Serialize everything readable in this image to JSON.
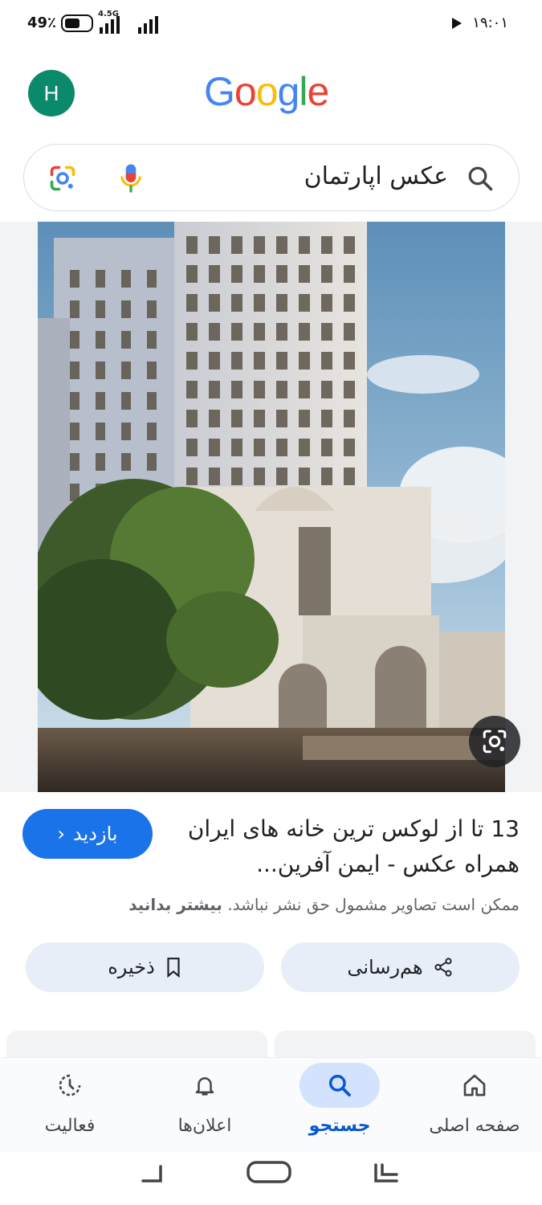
{
  "status_bar": {
    "battery": "49٪",
    "network": "4.5G",
    "time": "۱۹:۰۱"
  },
  "header": {
    "avatar_letter": "H",
    "logo_letters": [
      "G",
      "o",
      "o",
      "g",
      "l",
      "e"
    ],
    "logo_colors": [
      "#4285F4",
      "#EA4335",
      "#FBBC05",
      "#4285F4",
      "#34A853",
      "#EA4335"
    ]
  },
  "search": {
    "query": "عکس اپارتمان"
  },
  "result": {
    "title": "13 تا از لوکس ترین خانه های ایران همراه عکس - ایمن آفرین...",
    "visit_label": "بازدید",
    "copyright_text": "ممکن است تصاویر مشمول حق نشر نباشد.",
    "learn_more": "بیشتر بدانید",
    "share_label": "هم‌رسانی",
    "save_label": "ذخیره"
  },
  "bottom_nav": {
    "items": [
      {
        "label": "صفحه اصلی",
        "icon": "home-icon"
      },
      {
        "label": "جستجو",
        "icon": "search-icon"
      },
      {
        "label": "اعلان‌ها",
        "icon": "bell-icon"
      },
      {
        "label": "فعالیت",
        "icon": "activity-icon"
      }
    ],
    "active": "جستجو"
  },
  "colors": {
    "accent": "#1a73e8",
    "nav_active_bg": "#d3e3fd",
    "avatar_bg": "#0b8a6b"
  }
}
